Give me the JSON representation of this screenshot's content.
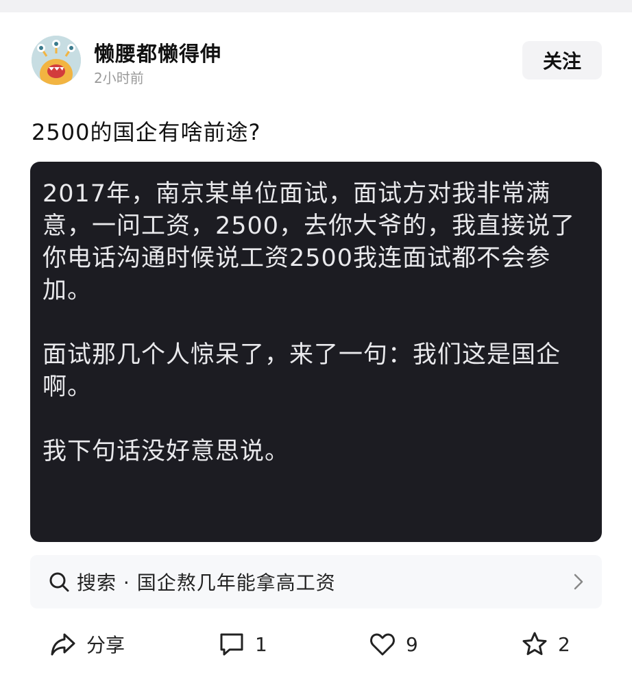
{
  "post": {
    "author": "懒腰都懒得伸",
    "time": "2小时前",
    "follow_label": "关注",
    "title": "2500的国企有啥前途?",
    "paragraphs": [
      "2017年，南京某单位面试，面试方对我非常满意，一问工资，2500，去你大爷的，我直接说了你电话沟通时候说工资2500我连面试都不会参加。",
      "面试那几个人惊呆了，来了一句：我们这是国企啊。",
      "我下句话没好意思说。"
    ]
  },
  "search": {
    "text": "搜索 · 国企熬几年能拿高工资",
    "icon": "search-icon"
  },
  "actions": {
    "share_label": "分享",
    "comment_count": "1",
    "like_count": "9",
    "favorite_count": "2"
  },
  "colors": {
    "card_bg": "#1c1c22",
    "card_text": "#e9e9ec",
    "avatar_bg": "#c7dde2",
    "avatar_creature": "#f2b441"
  }
}
